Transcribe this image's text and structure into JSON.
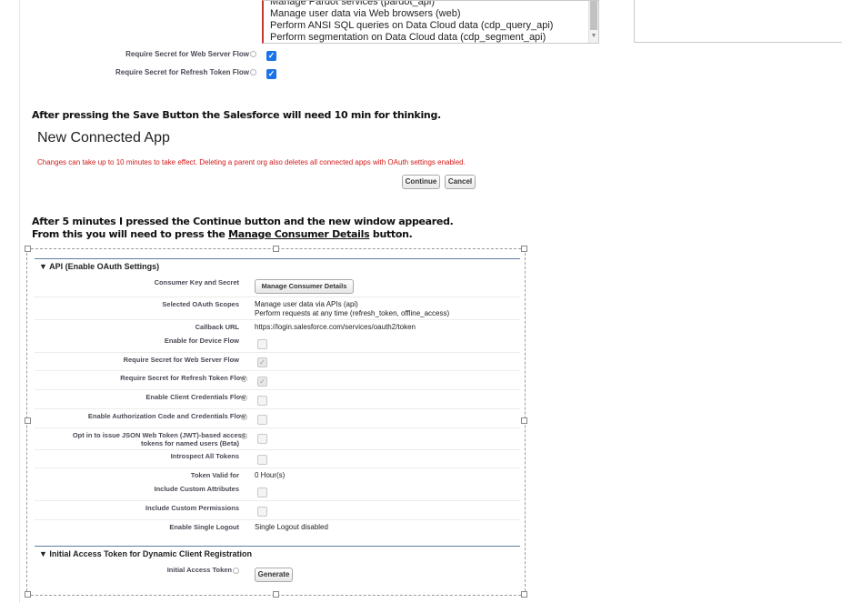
{
  "top": {
    "scope_items": [
      "Manage Pardot services (pardot_api)",
      "Manage user data via Web browsers (web)",
      "Perform ANSI SQL queries on Data Cloud data (cdp_query_api)",
      "Perform segmentation on Data Cloud data (cdp_segment_api)"
    ],
    "require_secret_web_label": "Require Secret for Web Server Flow",
    "require_secret_refresh_label": "Require Secret for Refresh Token Flow",
    "check": "✓"
  },
  "note1": "After pressing the Save Button the Salesforce will need 10 min for thinking.",
  "new_app": {
    "title": "New Connected App",
    "warning": "Changes can take up to 10 minutes to take effect. Deleting a parent org also deletes all connected apps with OAuth settings enabled.",
    "continue_label": "Continue",
    "cancel_label": "Cancel"
  },
  "note2": {
    "line1": "After 5 minutes I pressed the Continue button and the new window appeared.",
    "line2_prefix": "From this you will need to press the ",
    "line2_link": "Manage Consumer Details",
    "line2_suffix": " button."
  },
  "api": {
    "section_title": "▼ API (Enable OAuth Settings)",
    "consumer_key_label": "Consumer Key and Secret",
    "manage_consumer_label": "Manage Consumer Details",
    "selected_scopes_label": "Selected OAuth Scopes",
    "selected_scopes": [
      "Manage user data via APIs (api)",
      "Perform requests at any time (refresh_token, offline_access)"
    ],
    "callback_label": "Callback URL",
    "callback_value": "https://login.salesforce.com/services/oauth2/token",
    "device_flow_label": "Enable for Device Flow",
    "web_server_label": "Require Secret for Web Server Flow",
    "refresh_label": "Require Secret for Refresh Token Flow",
    "client_cred_label": "Enable Client Credentials Flow",
    "auth_code_label": "Enable Authorization Code and Credentials Flow",
    "jwt_label_1": "Opt in to issue JSON Web Token (JWT)-based access",
    "jwt_label_2": "tokens for named users (Beta)",
    "introspect_label": "Introspect All Tokens",
    "token_valid_label": "Token Valid for",
    "token_valid_value": "0 Hour(s)",
    "custom_attr_label": "Include Custom Attributes",
    "custom_perm_label": "Include Custom Permissions",
    "single_logout_label": "Enable Single Logout",
    "single_logout_value": "Single Logout disabled"
  },
  "initial": {
    "section_title": "▼ Initial Access Token for Dynamic Client Registration",
    "token_label": "Initial Access Token",
    "generate_label": "Generate"
  }
}
